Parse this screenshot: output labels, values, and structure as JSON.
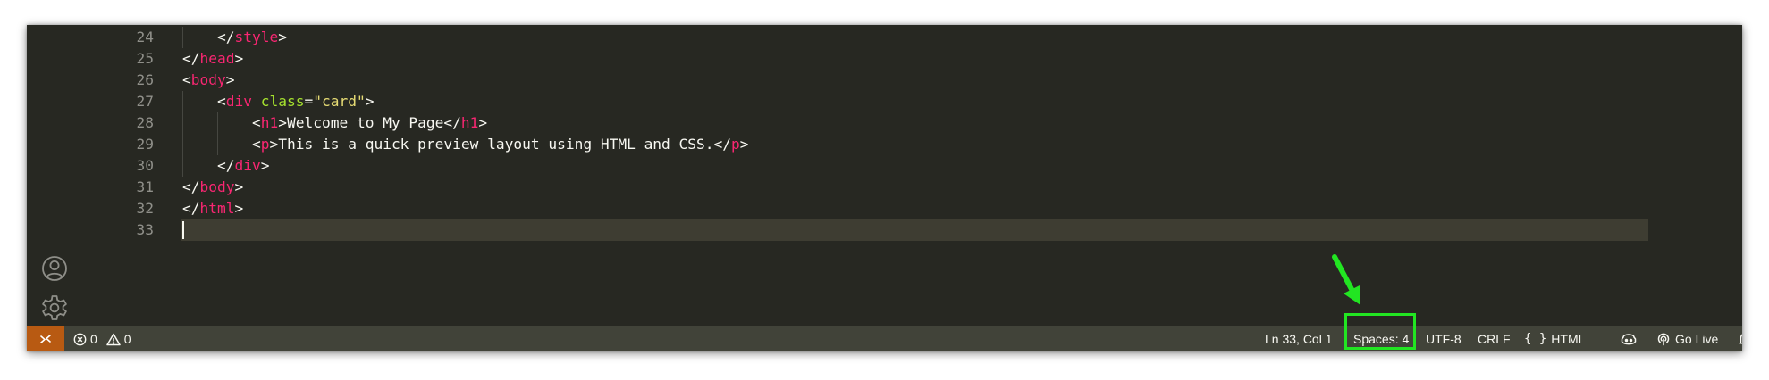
{
  "editor": {
    "lines": [
      {
        "number": "24",
        "indent": 1,
        "tokens": [
          [
            "pu",
            "</"
          ],
          [
            "tg",
            "style"
          ],
          [
            "pu",
            ">"
          ]
        ]
      },
      {
        "number": "25",
        "indent": 0,
        "tokens": [
          [
            "pu",
            "</"
          ],
          [
            "tg",
            "head"
          ],
          [
            "pu",
            ">"
          ]
        ]
      },
      {
        "number": "26",
        "indent": 0,
        "tokens": [
          [
            "pu",
            "<"
          ],
          [
            "tg",
            "body"
          ],
          [
            "pu",
            ">"
          ]
        ]
      },
      {
        "number": "27",
        "indent": 1,
        "tokens": [
          [
            "pu",
            "<"
          ],
          [
            "tg",
            "div"
          ],
          [
            "pu",
            " "
          ],
          [
            "at",
            "class"
          ],
          [
            "pu",
            "="
          ],
          [
            "st",
            "\"card\""
          ],
          [
            "pu",
            ">"
          ]
        ]
      },
      {
        "number": "28",
        "indent": 2,
        "tokens": [
          [
            "pu",
            "<"
          ],
          [
            "tg",
            "h1"
          ],
          [
            "pu",
            ">Welcome to My Page</"
          ],
          [
            "tg",
            "h1"
          ],
          [
            "pu",
            ">"
          ]
        ]
      },
      {
        "number": "29",
        "indent": 2,
        "tokens": [
          [
            "pu",
            "<"
          ],
          [
            "tg",
            "p"
          ],
          [
            "pu",
            ">This is a quick preview layout using HTML and CSS.</"
          ],
          [
            "tg",
            "p"
          ],
          [
            "pu",
            ">"
          ]
        ]
      },
      {
        "number": "30",
        "indent": 1,
        "tokens": [
          [
            "pu",
            "</"
          ],
          [
            "tg",
            "div"
          ],
          [
            "pu",
            ">"
          ]
        ]
      },
      {
        "number": "31",
        "indent": 0,
        "tokens": [
          [
            "pu",
            "</"
          ],
          [
            "tg",
            "body"
          ],
          [
            "pu",
            ">"
          ]
        ]
      },
      {
        "number": "32",
        "indent": 0,
        "tokens": [
          [
            "pu",
            "</"
          ],
          [
            "tg",
            "html"
          ],
          [
            "pu",
            ">"
          ]
        ]
      },
      {
        "number": "33",
        "indent": 0,
        "tokens": [],
        "current": true
      }
    ]
  },
  "activity_bar": {
    "account_icon": "account-icon",
    "settings_icon": "gear-icon"
  },
  "status_bar": {
    "errors": "0",
    "warnings": "0",
    "cursor_position": "Ln 33, Col 1",
    "indentation": "Spaces: 4",
    "encoding": "UTF-8",
    "line_ending": "CRLF",
    "language": "HTML",
    "go_live": "Go Live"
  },
  "colors": {
    "editor_background": "#272822",
    "status_bar_background": "#414339",
    "remote_button": "#b85a12",
    "annotation": "#22e522"
  }
}
